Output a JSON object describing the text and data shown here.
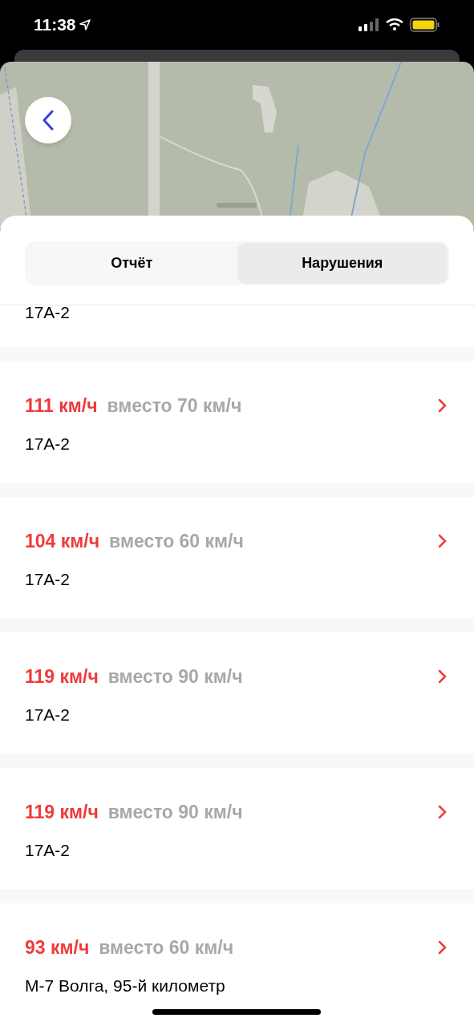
{
  "status_bar": {
    "time": "11:38"
  },
  "tabs": [
    {
      "label": "Отчёт",
      "selected": false
    },
    {
      "label": "Нарушения",
      "selected": true
    }
  ],
  "partial_item": {
    "road": "17A-2"
  },
  "violations": [
    {
      "speed": "111 км/ч",
      "limit": "вместо 70 км/ч",
      "road": "17A-2"
    },
    {
      "speed": "104 км/ч",
      "limit": "вместо 60 км/ч",
      "road": "17A-2"
    },
    {
      "speed": "119 км/ч",
      "limit": "вместо 90 км/ч",
      "road": "17A-2"
    },
    {
      "speed": "119 км/ч",
      "limit": "вместо 90 км/ч",
      "road": "17A-2"
    },
    {
      "speed": "93 км/ч",
      "limit": "вместо 60 км/ч",
      "road": "М-7 Волга, 95-й километр"
    }
  ]
}
